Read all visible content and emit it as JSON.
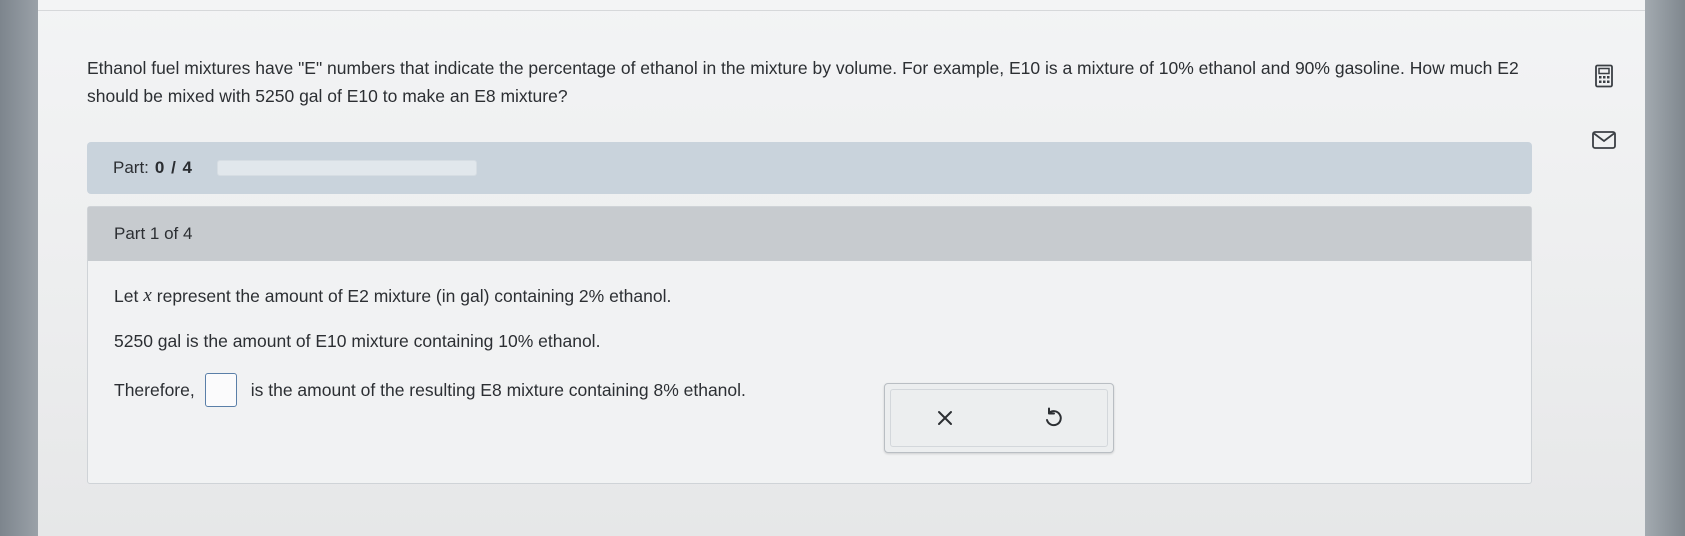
{
  "question": {
    "text": "Ethanol fuel mixtures have \"E\" numbers that indicate the percentage of ethanol in the mixture by volume. For example, E10 is a mixture of 10% ethanol and 90% gasoline. How much E2 should be mixed with 5250 gal of E10 to make an E8 mixture?"
  },
  "side_tools": {
    "calculator_icon": "calculator-icon",
    "mail_icon": "mail-icon"
  },
  "progress": {
    "label": "Part:",
    "count": "0 / 4",
    "fraction": 0.0
  },
  "part": {
    "header": "Part 1 of 4",
    "line1_pre": "Let",
    "line1_var": "x",
    "line1_post": "represent the amount of E2 mixture (in gal) containing 2% ethanol.",
    "line2": "5250 gal is the amount of E10 mixture containing 10% ethanol.",
    "line3_pre": "Therefore,",
    "line3_post": "is the amount of the resulting E8 mixture containing 8% ethanol."
  },
  "actions": {
    "clear_icon": "close-icon",
    "undo_icon": "undo-icon",
    "clear_symbol": "×"
  },
  "colors": {
    "accent": "#4a90c8",
    "part_bar": "#c9d3dc",
    "header": "#c7cbcf"
  }
}
